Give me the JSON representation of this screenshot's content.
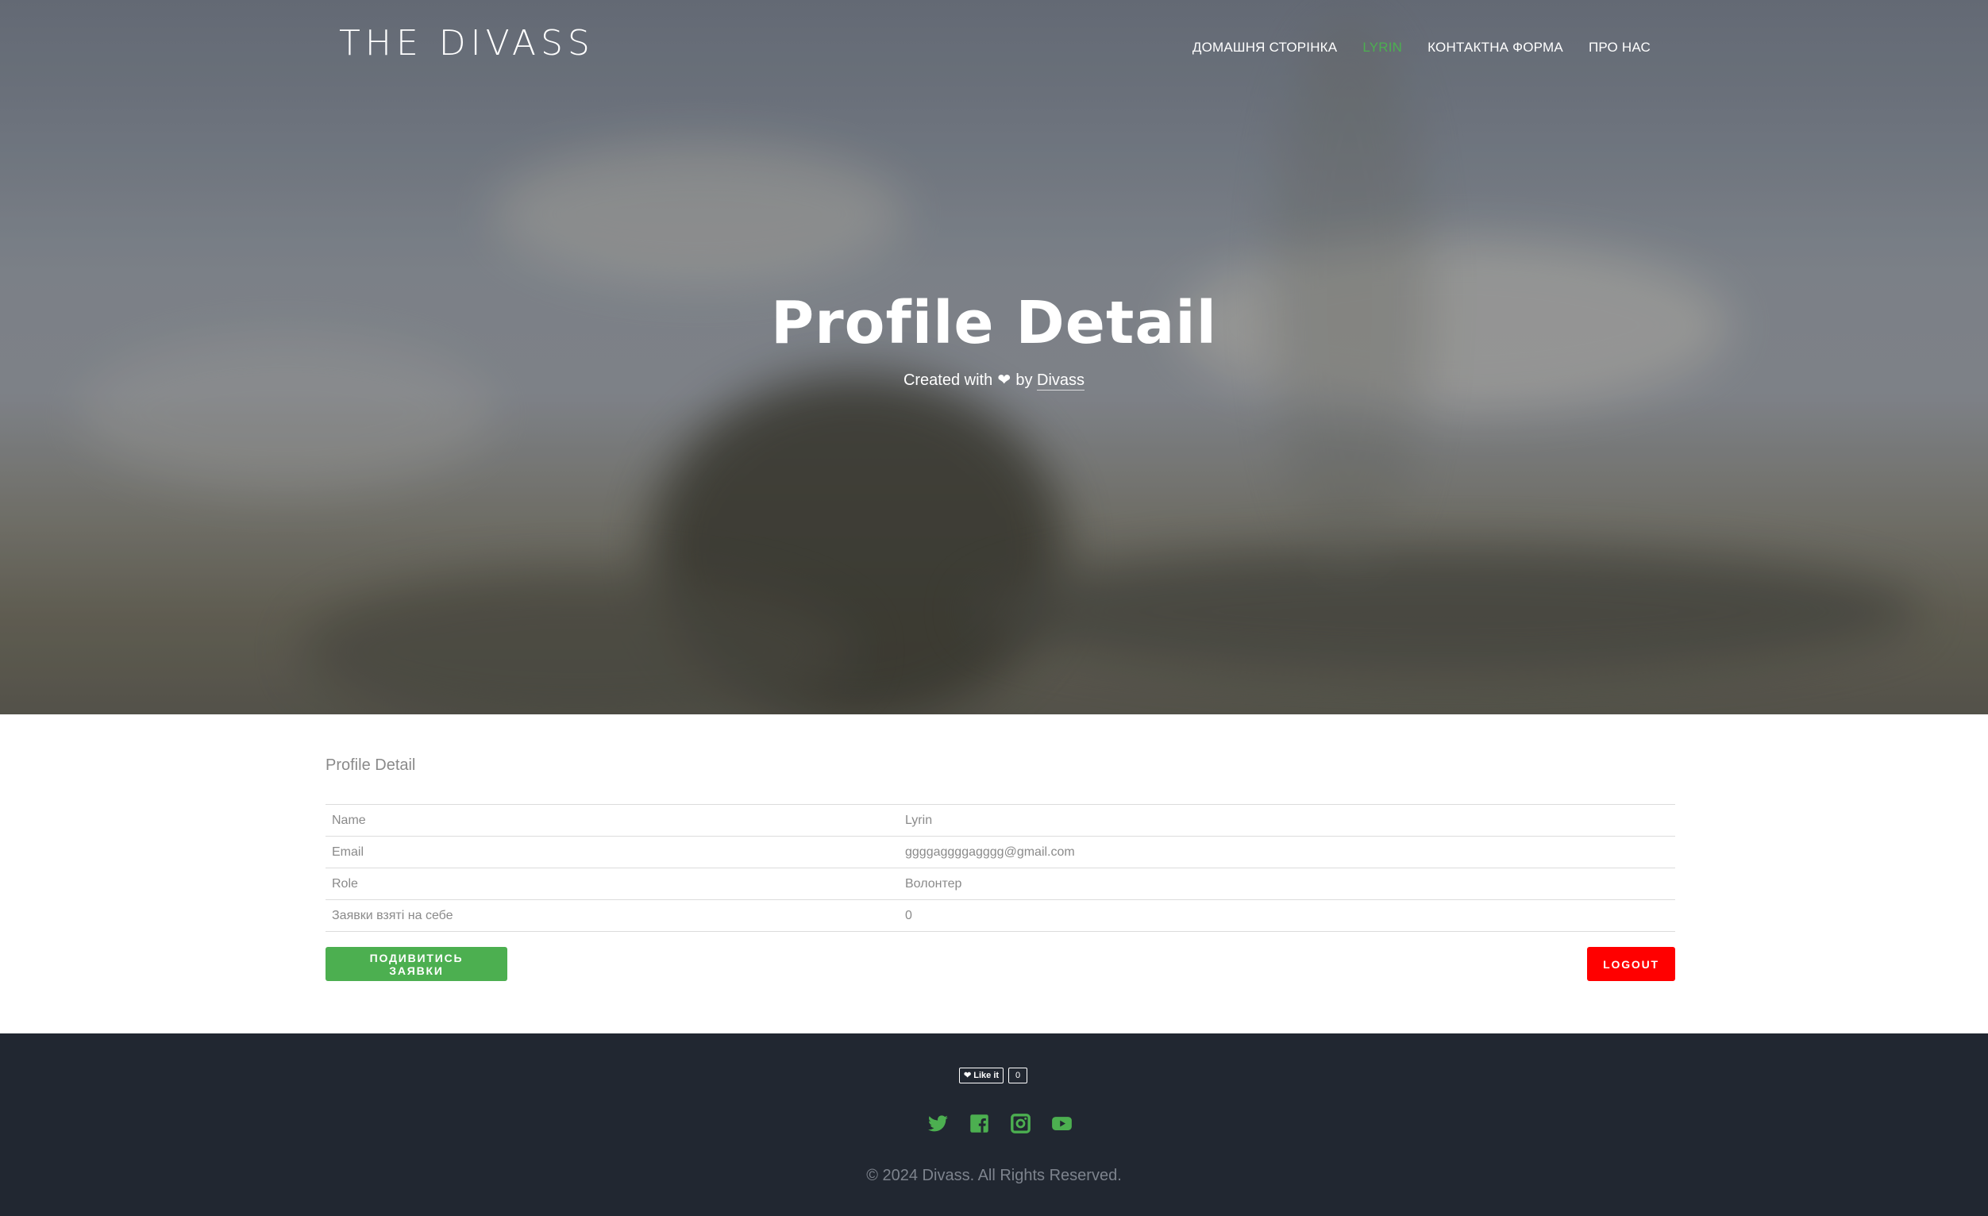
{
  "header": {
    "logo": "THE DIVASS",
    "nav": [
      {
        "label": "ДОМАШНЯ СТОРІНКА"
      },
      {
        "label": "LYRIN"
      },
      {
        "label": "КОНТАКТНА ФОРМА"
      },
      {
        "label": "ПРО НАС"
      }
    ]
  },
  "hero": {
    "title": "Profile Detail",
    "subtitle_prefix": "Created with",
    "subtitle_by": "by",
    "author": "Divass"
  },
  "profile": {
    "section_title": "Profile Detail",
    "rows": [
      {
        "label": "Name",
        "value": "Lyrin"
      },
      {
        "label": "Email",
        "value": "ggggaggggagggg@gmail.com"
      },
      {
        "label": "Role",
        "value": "Волонтер"
      },
      {
        "label": "Заявки взяті на себе",
        "value": "0"
      }
    ],
    "view_requests_label": "ПОДИВИТИСЬ ЗАЯВКИ",
    "logout_label": "LOGOUT"
  },
  "footer": {
    "like_label": "Like it",
    "like_count": "0",
    "social": [
      "twitter-icon",
      "facebook-icon",
      "instagram-icon",
      "youtube-icon"
    ],
    "copyright": "© 2024 Divass. All Rights Reserved."
  },
  "colors": {
    "accent_green": "#4caf50",
    "logout_red": "#ff0000",
    "footer_bg": "#212731"
  }
}
